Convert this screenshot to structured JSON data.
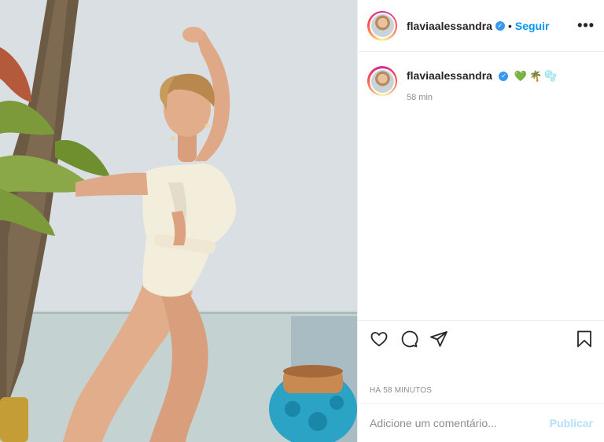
{
  "post": {
    "username": "flaviaalessandra",
    "verified": true,
    "follow_label": "Seguir",
    "dot": "•",
    "more_label": "•••"
  },
  "caption": {
    "username": "flaviaalessandra",
    "emojis": [
      "💚",
      "🌴",
      "🫧"
    ],
    "time": "58 min"
  },
  "actions": {
    "like": "heart-icon",
    "comment": "comment-icon",
    "share": "paper-plane-icon",
    "save": "bookmark-icon"
  },
  "timestamp": "HÁ 58 MINUTOS",
  "comment_box": {
    "placeholder": "Adicione um comentário...",
    "publish_label": "Publicar"
  },
  "colors": {
    "accent": "#0095f6",
    "publish_disabled": "#b2dffc",
    "verified": "#3897f0",
    "divider": "#efefef"
  }
}
